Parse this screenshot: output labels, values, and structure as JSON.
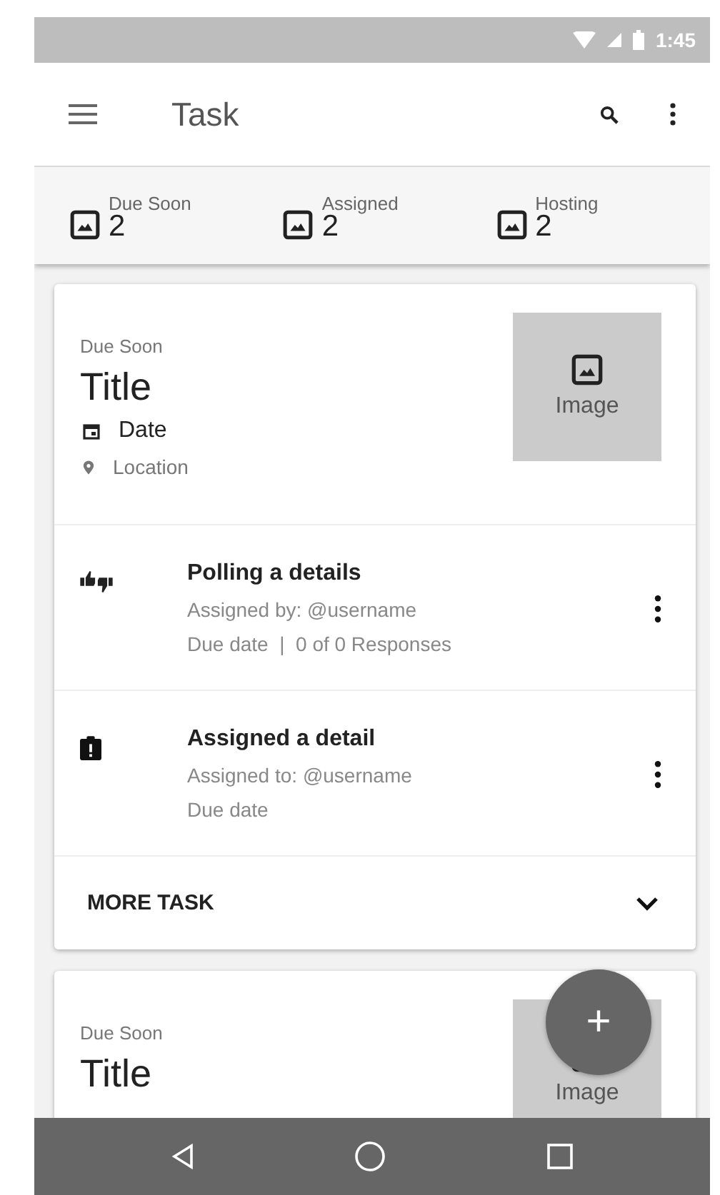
{
  "status_bar": {
    "time": "1:45"
  },
  "app_bar": {
    "title": "Task"
  },
  "stats": [
    {
      "label": "Due Soon",
      "count": "2"
    },
    {
      "label": "Assigned",
      "count": "2"
    },
    {
      "label": "Hosting",
      "count": "2"
    }
  ],
  "cards": [
    {
      "status": "Due Soon",
      "title": "Title",
      "date": "Date",
      "location": "Location",
      "image_label": "Image",
      "tasks": [
        {
          "kind": "poll",
          "title": "Polling a details",
          "lines": [
            "Assigned by: @username",
            "Due date  |  0 of 0 Responses"
          ]
        },
        {
          "kind": "assigned",
          "title": "Assigned a detail",
          "lines": [
            "Assigned to: @username",
            "Due date"
          ]
        }
      ],
      "more": "MORE TASK"
    },
    {
      "status": "Due Soon",
      "title": "Title",
      "image_label": "Image"
    }
  ],
  "fab": {
    "label": "+"
  }
}
